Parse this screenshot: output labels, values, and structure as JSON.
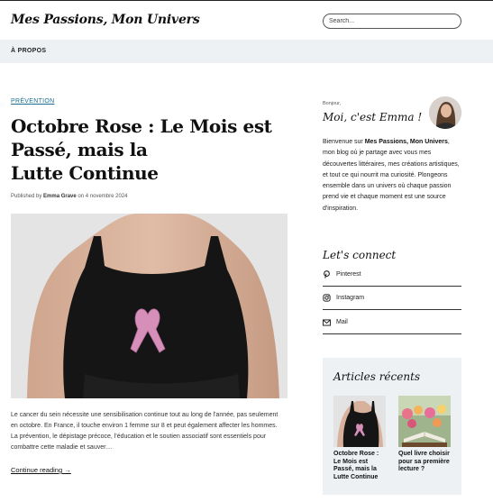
{
  "site": {
    "title": "Mes Passions, Mon Univers"
  },
  "search": {
    "placeholder": "Search..."
  },
  "nav": {
    "items": [
      {
        "label": "À PROPOS"
      }
    ]
  },
  "post": {
    "category": "PRÉVENTION",
    "title_line1": "Octobre Rose : Le Mois est",
    "title_line2": "Passé, mais la",
    "title_line3": "Lutte Continue",
    "byline_prefix": "Published by",
    "author": "Emma Grave",
    "byline_on": "on",
    "date": "4 novembre 2024",
    "image": "woman-black-top-pink-ribbon-photo",
    "excerpt": "Le cancer du sein nécessite une sensibilisation continue tout au long de l'année, pas seulement en octobre. En France, il touche environ 1 femme sur 8 et peut également affecter les hommes. La prévention, le dépistage précoce, l'éducation et le soutien associatif sont essentiels pour combattre cette maladie et sauver…",
    "read_more": "Continue reading →"
  },
  "sidebar": {
    "greeting": "Bonjour,",
    "name": "Moi, c'est Emma !",
    "avatar": "avatar-photo",
    "bio_prefix": "Bienvenue sur ",
    "bio_bold": "Mes Passions, Mon Univers",
    "bio_rest": ", mon blog où je partage avec vous mes découvertes littéraires, mes créations artistiques, et tout ce qui nourrit ma curiosité. Plongeons ensemble dans un univers où chaque passion prend vie et chaque moment est une source d'inspiration.",
    "connect_title": "Let's connect",
    "social": [
      {
        "label": "Pinterest",
        "icon": "pinterest-icon"
      },
      {
        "label": "Instagram",
        "icon": "instagram-icon"
      },
      {
        "label": "Mail",
        "icon": "mail-icon"
      }
    ],
    "recent_title": "Articles récents",
    "recent": [
      {
        "title": "Octobre Rose : Le Mois est Passé, mais la Lutte Continue",
        "image": "black-top-ribbon-thumbnail"
      },
      {
        "title": "Quel livre choisir pour sa première lecture ?",
        "image": "book-flowers-thumbnail"
      }
    ]
  },
  "colors": {
    "accent": "#1b6e8e",
    "nav_bg": "#eef1f4",
    "ribbon": "#d58fb8"
  }
}
